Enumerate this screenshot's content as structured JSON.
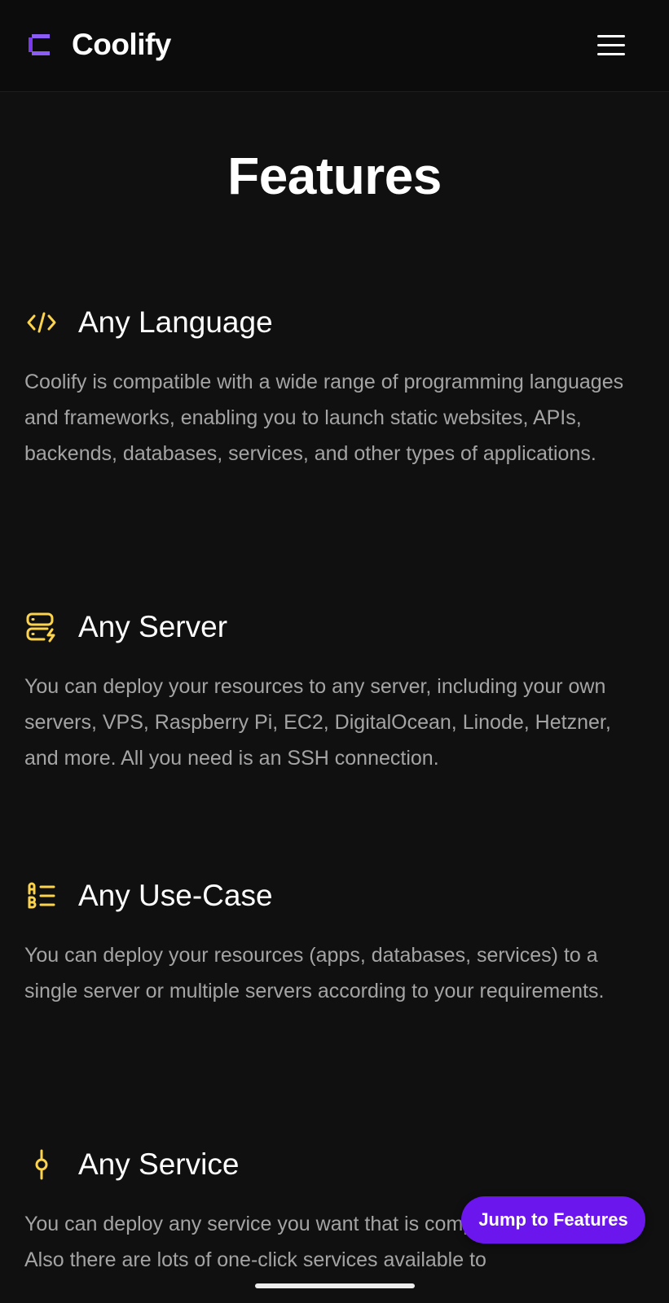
{
  "header": {
    "brand_name": "Coolify",
    "logo_icon": "coolify-logo-icon",
    "menu_icon": "hamburger-menu-icon"
  },
  "page": {
    "title": "Features"
  },
  "features": [
    {
      "icon": "code-icon",
      "title": "Any Language",
      "description": "Coolify is compatible with a wide range of programming languages and frameworks, enabling you to launch static websites, APIs, backends, databases, services, and other types of applications."
    },
    {
      "icon": "server-bolt-icon",
      "title": "Any Server",
      "description": "You can deploy your resources to any server, including your own servers, VPS, Raspberry Pi, EC2, DigitalOcean, Linode, Hetzner, and more. All you need is an SSH connection."
    },
    {
      "icon": "list-letters-icon",
      "title": "Any Use-Case",
      "description": "You can deploy your resources (apps, databases, services) to a single server or multiple servers according to your requirements."
    },
    {
      "icon": "git-commit-icon",
      "title": "Any Service",
      "description": "You can deploy any service you want that is compatible with Docker. Also there are lots of one-click services available to"
    }
  ],
  "floating": {
    "jump_label": "Jump to Features"
  },
  "colors": {
    "background": "#101010",
    "accent_purple": "#6b16ed",
    "logo_purple": "#7c3aed",
    "icon_yellow": "#fcd34d",
    "text_muted": "#a4a4a4"
  }
}
